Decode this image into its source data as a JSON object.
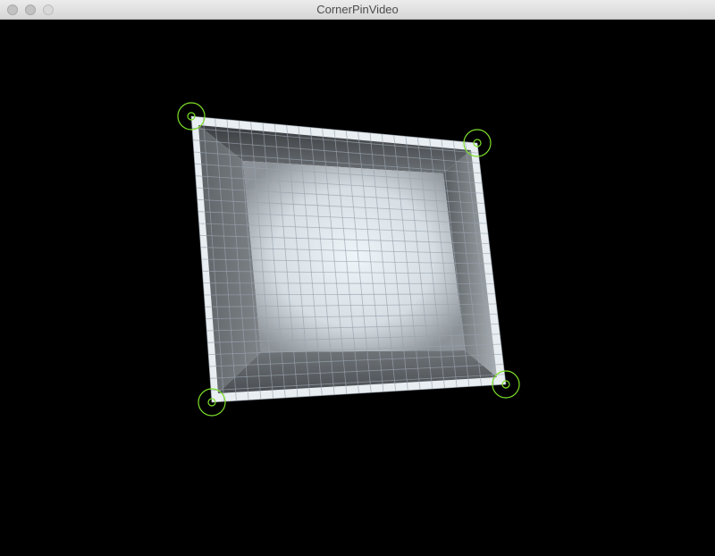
{
  "window": {
    "title": "CornerPinVideo",
    "controls": {
      "close_icon": "close-icon",
      "minimize_icon": "minimize-icon",
      "zoom_icon": "zoom-icon"
    }
  },
  "canvas": {
    "background": "#000000",
    "grid_color": "#9aa3ad",
    "handle_color": "#7ee02a",
    "handle_icon": "target-circle-icon",
    "grid_divisions": 24
  }
}
